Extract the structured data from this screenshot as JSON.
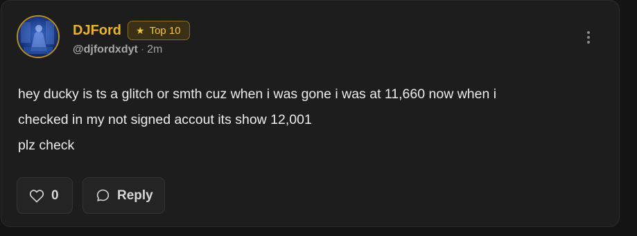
{
  "post": {
    "author": {
      "display_name": "DJFord",
      "handle": "@djfordxdyt",
      "time_separator": "·",
      "time_ago": "2m",
      "badge": {
        "icon": "star-icon",
        "label": "Top 10"
      },
      "avatar": "avatar-image"
    },
    "menu_icon": "more-vertical-icon",
    "body_lines": [
      "hey ducky is ts a glitch or smth cuz when i was gone i was at 11,660 now when i",
      "checked in my not signed accout its show 12,001",
      "plz check"
    ],
    "actions": {
      "like": {
        "icon": "heart-icon",
        "count": "0"
      },
      "reply": {
        "icon": "chat-bubble-icon",
        "label": "Reply"
      }
    }
  },
  "colors": {
    "background": "#141414",
    "card": "#1d1d1d",
    "accent_gold": "#eab42e",
    "badge_bg": "#3a3016",
    "text_primary": "#ececec",
    "text_muted": "#a4a4a4"
  }
}
